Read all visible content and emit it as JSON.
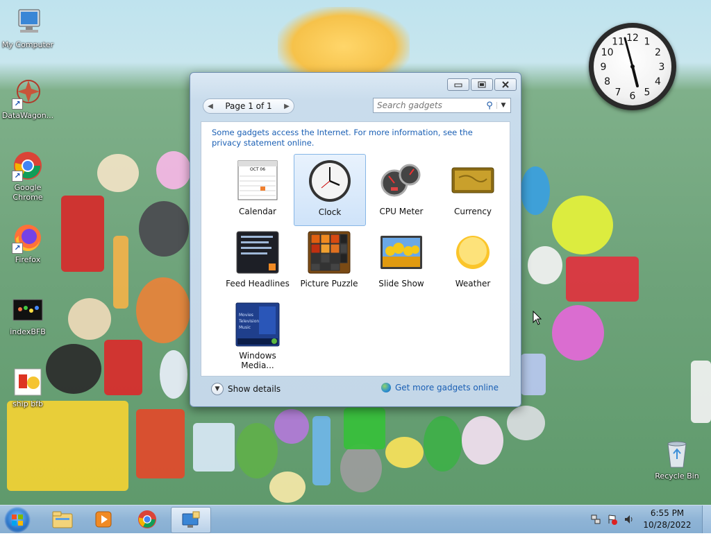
{
  "desktop": {
    "icons": [
      {
        "label": "My Computer"
      },
      {
        "label": "DataWagon..."
      },
      {
        "label": "Google Chrome"
      },
      {
        "label": "Firefox"
      },
      {
        "label": "indexBFB"
      },
      {
        "label": "ship bfb"
      },
      {
        "label": "Recycle Bin"
      }
    ],
    "clock_gadget": {
      "numerals": [
        "12",
        "1",
        "2",
        "3",
        "4",
        "5",
        "6",
        "7",
        "8",
        "9",
        "10",
        "11"
      ]
    }
  },
  "gallery": {
    "pager_label": "Page 1 of 1",
    "search_placeholder": "Search gadgets",
    "notice": "Some gadgets access the Internet.  For more information, see the privacy statement online.",
    "gadgets": [
      {
        "label": "Calendar",
        "icon": "calendar-icon"
      },
      {
        "label": "Clock",
        "icon": "clock-icon",
        "selected": true
      },
      {
        "label": "CPU Meter",
        "icon": "cpu-meter-icon"
      },
      {
        "label": "Currency",
        "icon": "currency-icon"
      },
      {
        "label": "Feed Headlines",
        "icon": "feed-headlines-icon"
      },
      {
        "label": "Picture Puzzle",
        "icon": "picture-puzzle-icon"
      },
      {
        "label": "Slide Show",
        "icon": "slide-show-icon"
      },
      {
        "label": "Weather",
        "icon": "weather-icon"
      },
      {
        "label": "Windows Media...",
        "icon": "windows-media-icon"
      }
    ],
    "calendar_month": "OCT 06",
    "media_menu": [
      "Movies",
      "Television",
      "Music"
    ],
    "show_details": "Show details",
    "more_gadgets": "Get more gadgets online"
  },
  "taskbar": {
    "apps": [
      {
        "icon": "windows-explorer-icon"
      },
      {
        "icon": "media-player-icon"
      },
      {
        "icon": "chrome-icon"
      },
      {
        "icon": "gadgets-icon",
        "active": true
      }
    ],
    "time": "6:55 PM",
    "date": "10/28/2022"
  }
}
